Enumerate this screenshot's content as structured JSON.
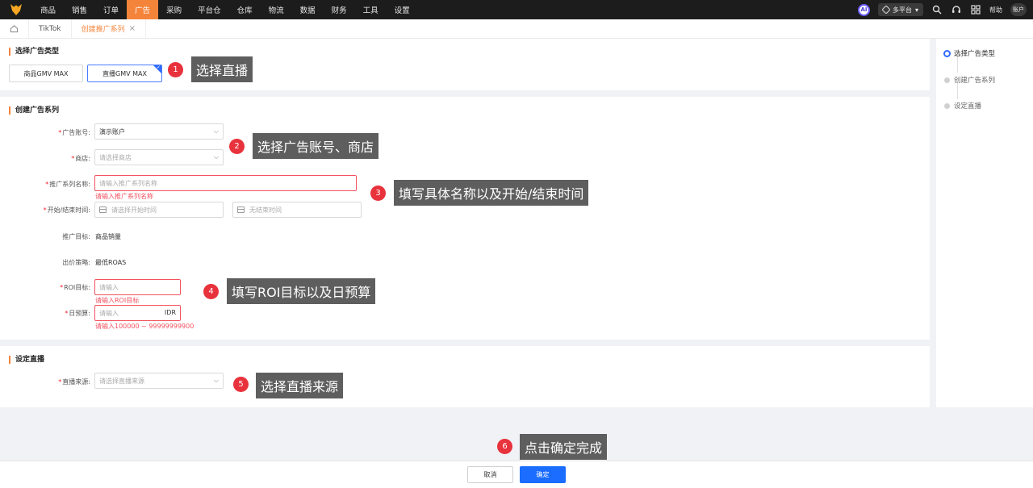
{
  "topnav": {
    "items": [
      "商品",
      "销售",
      "订单",
      "广告",
      "采购",
      "平台仓",
      "仓库",
      "物流",
      "数据",
      "财务",
      "工具",
      "设置"
    ],
    "active_item": "广告",
    "ai_label": "AI",
    "platform_label": "多平台",
    "help_label": "帮助",
    "account_label": "账户"
  },
  "tabs": {
    "items": [
      "TikTok",
      "创建推广系列"
    ],
    "active": "创建推广系列"
  },
  "ad_type": {
    "title": "选择广告类型",
    "options": [
      "商品GMV MAX",
      "直播GMV MAX"
    ],
    "selected": "直播GMV MAX"
  },
  "campaign": {
    "title": "创建广告系列",
    "account_label": "广告账号:",
    "account_value": "演示账户",
    "shop_label": "商店:",
    "shop_placeholder": "请选择商店",
    "name_label": "推广系列名称:",
    "name_placeholder": "请输入推广系列名称",
    "name_error": "请输入推广系列名称",
    "time_label": "开始/结束时间:",
    "start_placeholder": "请选择开始时间",
    "end_placeholder": "无结束时间",
    "goal_label": "推广目标:",
    "goal_value": "商品销量",
    "bid_label": "出价策略:",
    "bid_value": "最低ROAS",
    "roi_label": "ROI目标:",
    "roi_placeholder": "请输入",
    "roi_error": "请输入ROI目标",
    "budget_label": "日预算:",
    "budget_placeholder": "请输入",
    "budget_currency": "IDR",
    "budget_error": "请输入100000 ~ 99999999900"
  },
  "live": {
    "title": "设定直播",
    "source_label": "直播来源:",
    "source_placeholder": "请选择直播来源"
  },
  "steps": [
    "选择广告类型",
    "创建广告系列",
    "设定直播"
  ],
  "active_step": 0,
  "annotations": [
    {
      "num": "1",
      "text": "选择直播"
    },
    {
      "num": "2",
      "text": "选择广告账号、商店"
    },
    {
      "num": "3",
      "text": "填写具体名称以及开始/结束时间"
    },
    {
      "num": "4",
      "text": "填写ROI目标以及日预算"
    },
    {
      "num": "5",
      "text": "选择直播来源"
    },
    {
      "num": "6",
      "text": "点击确定完成"
    }
  ],
  "footer": {
    "cancel_label": "取消",
    "ok_label": "确定"
  },
  "colors": {
    "accent": "#f5843b",
    "primary": "#1a6dff",
    "error": "#f5515f",
    "callout_bg": "#5e5e5e",
    "callout_num": "#e8323c"
  }
}
